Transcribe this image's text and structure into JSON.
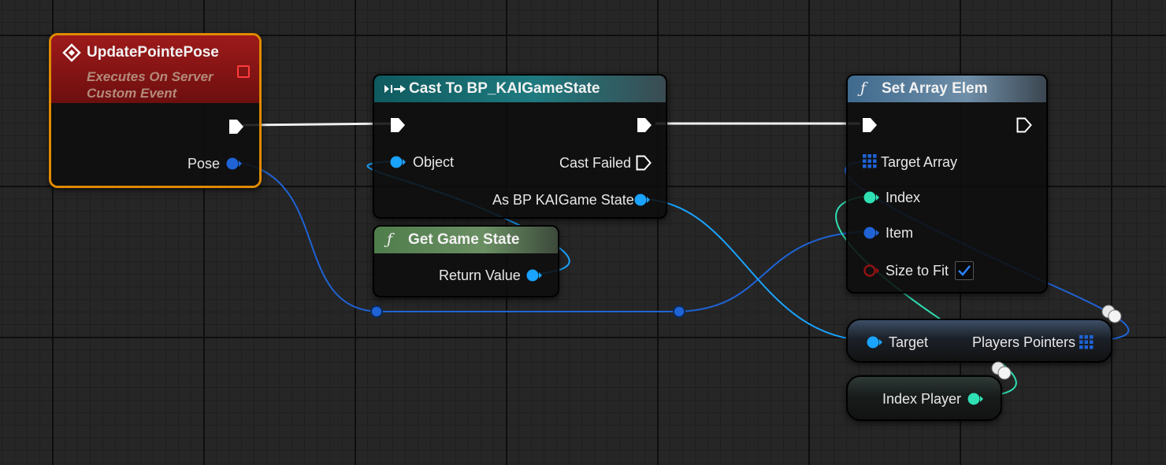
{
  "event_node": {
    "title": "UpdatePointePose",
    "subtitle_line1": "Executes On Server",
    "subtitle_line2": "Custom Event",
    "pose_label": "Pose"
  },
  "cast_node": {
    "title": "Cast To BP_KAIGameState",
    "object_label": "Object",
    "cast_failed_label": "Cast Failed",
    "as_label": "As BP KAIGame State"
  },
  "get_game_state_node": {
    "title": "Get Game State",
    "return_label": "Return Value"
  },
  "set_array_node": {
    "title": "Set Array Elem",
    "target_array_label": "Target Array",
    "index_label": "Index",
    "item_label": "Item",
    "size_to_fit_label": "Size to Fit",
    "size_to_fit_checked": true
  },
  "players_pointers_node": {
    "target_label": "Target",
    "output_label": "Players Pointers"
  },
  "index_player_node": {
    "label": "Index Player"
  },
  "colors": {
    "exec": "#ffffff",
    "object_pin": "#1aa3ff",
    "struct_pin": "#1f63d6",
    "int_pin": "#2fe0b4",
    "bool_pin": "#8f1111",
    "event_header": "#8c1212",
    "event_border": "#e08a00",
    "cast_header": "#1e6a6f",
    "pure_func_header": "#5d8a5a",
    "func_header": "#4a6e8c"
  }
}
